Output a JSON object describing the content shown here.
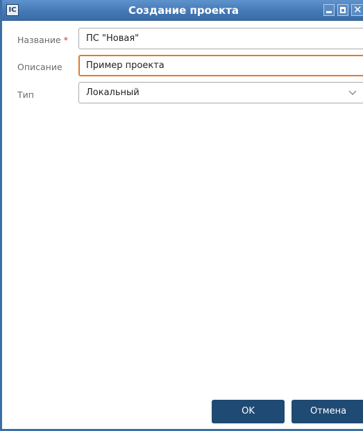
{
  "window": {
    "title": "Создание проекта",
    "app_icon_text": "IC"
  },
  "form": {
    "name": {
      "label": "Название",
      "required_mark": "*",
      "value": "ПС \"Новая\""
    },
    "description": {
      "label": "Описание",
      "value": "Пример проекта"
    },
    "type": {
      "label": "Тип",
      "selected": "Локальный"
    }
  },
  "buttons": {
    "ok_label": "OK",
    "cancel_label": "Отмена"
  },
  "colors": {
    "titlebar": "#4479b6",
    "focus_border": "#e07a2a",
    "button_bg": "#1f4a73",
    "required": "#d62b2b"
  }
}
